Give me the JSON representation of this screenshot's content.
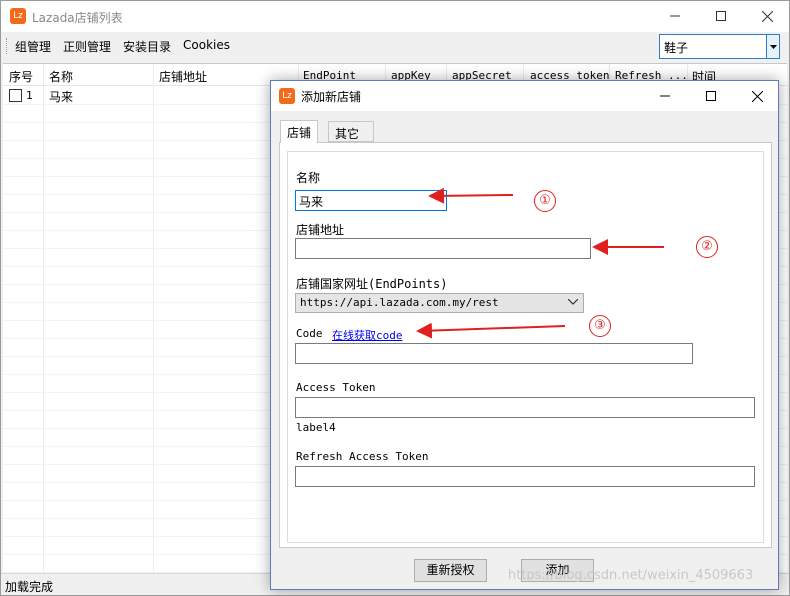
{
  "main": {
    "title": "Lazada店铺列表",
    "icon_letter": "Lz",
    "menu": [
      "组管理",
      "正则管理",
      "安装目录",
      "Cookies"
    ],
    "group_select": "鞋子",
    "columns": [
      "序号",
      "名称",
      "店铺地址",
      "EndPoint",
      "appKey",
      "appSecret",
      "access_token",
      "Refresh ...",
      "时间"
    ],
    "rows": [
      {
        "index": "1",
        "name": "马来",
        "checked": false
      }
    ],
    "status": "加载完成"
  },
  "dialog": {
    "title": "添加新店铺",
    "tabs": [
      "店铺",
      "其它"
    ],
    "name_label": "名称",
    "name_value": "马来",
    "address_label": "店铺地址",
    "address_value": "",
    "endpoint_label": "店铺国家网址(EndPoints)",
    "endpoint_value": "https://api.lazada.com.my/rest",
    "code_label": "Code",
    "code_link": "在线获取code",
    "code_value": "",
    "access_token_label": "Access Token",
    "access_token_value": "",
    "label4": "label4",
    "refresh_token_label": "Refresh Access Token",
    "refresh_token_value": "",
    "reauth_button": "重新授权",
    "add_button": "添加"
  },
  "annotations": [
    "①",
    "②",
    "③"
  ],
  "watermark": "https://blog.csdn.net/weixin_4509663",
  "colors": {
    "annotation": "#e02020",
    "focus": "#0078d7",
    "app_icon": "#f26a1b"
  }
}
